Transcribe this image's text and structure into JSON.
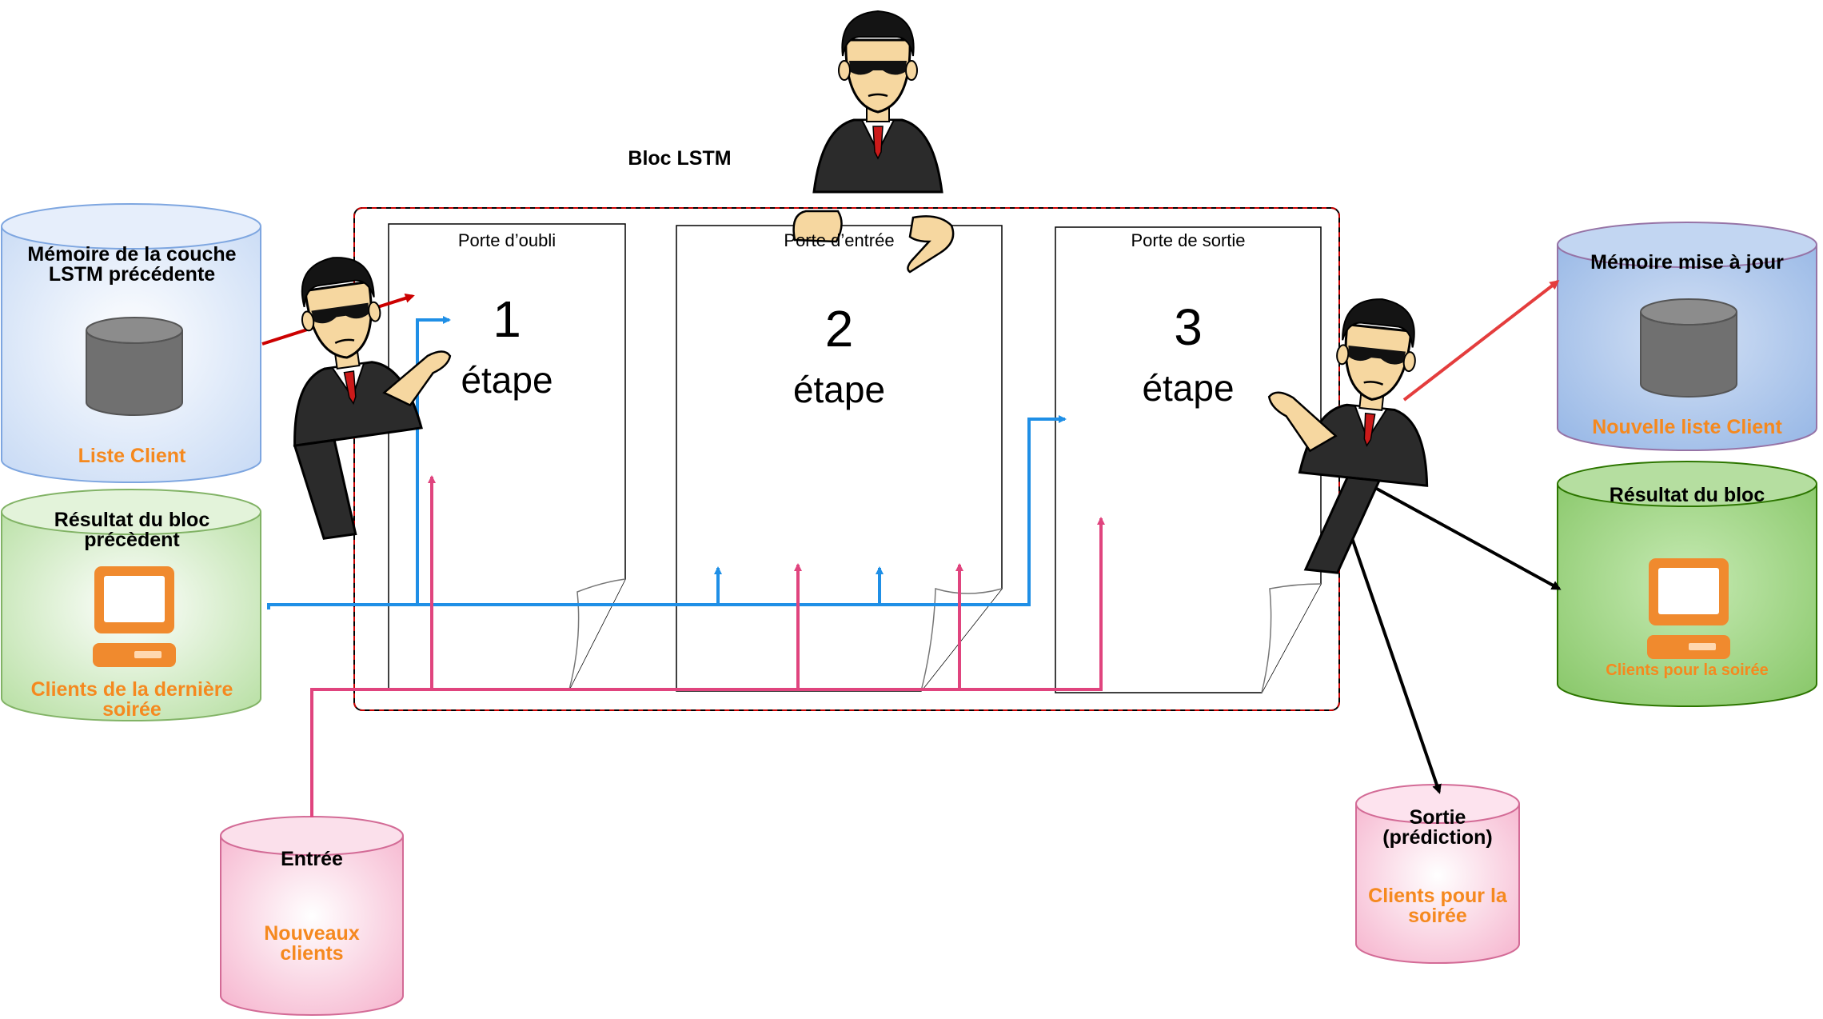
{
  "block_title": "Bloc LSTM",
  "gates": [
    {
      "label": "Porte d’oubli",
      "number": "1",
      "step": "étape"
    },
    {
      "label": "Porte d’entrée",
      "number": "2",
      "step": "étape"
    },
    {
      "label": "Porte de sortie",
      "number": "3",
      "step": "étape"
    }
  ],
  "prev_memory": {
    "title": "Mémoire de la couche LSTM précédente",
    "caption": "Liste Client",
    "color": "#dae8fc"
  },
  "prev_result": {
    "title": "Résultat du bloc précèdent",
    "caption": "Clients de la dernière soirée",
    "color": "#d5e8d4"
  },
  "input": {
    "title": "Entrée",
    "caption": "Nouveaux clients",
    "color": "#f8cecc"
  },
  "new_memory": {
    "title": "Mémoire mise à jour",
    "caption": "Nouvelle liste Client",
    "color": "#a9c4eb"
  },
  "block_result": {
    "title": "Résultat du bloc",
    "caption": "Clients pour la soirée",
    "color": "#97d077"
  },
  "output": {
    "title": "Sortie (prédiction)",
    "caption": "Clients pour la soirée",
    "color": "#ffccdd"
  },
  "colors": {
    "blue_arrow": "#1f8fe6",
    "pink_arrow": "#e0447e",
    "red_arrow": "#e43d3d",
    "dark_red": "#cc0000",
    "orange_text": "#f5891f"
  },
  "icons": [
    "database-icon",
    "computer-icon",
    "bodyguard-figure"
  ]
}
